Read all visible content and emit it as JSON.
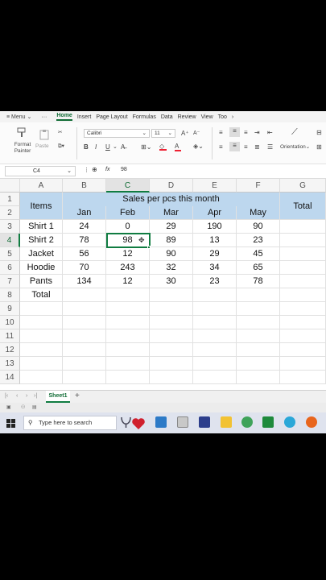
{
  "ribbon_tabs": [
    "Menu",
    "Home",
    "Insert",
    "Page Layout",
    "Formulas",
    "Data",
    "Review",
    "View",
    "Too"
  ],
  "ribbon": {
    "format_painter": "Format Painter",
    "paste": "Paste",
    "font_name": "Calibri",
    "font_size": "11",
    "orientation": "Orientation"
  },
  "formula_bar": {
    "name_box": "C4",
    "fx_label": "fx",
    "formula": "98"
  },
  "columns": [
    "A",
    "B",
    "C",
    "D",
    "E",
    "F",
    "G"
  ],
  "rows": [
    "1",
    "2",
    "3",
    "4",
    "5",
    "6",
    "7",
    "8",
    "9",
    "10",
    "11",
    "12",
    "13",
    "14"
  ],
  "table": {
    "items_header": "Items",
    "title": "Sales per pcs this month",
    "total_header": "Total",
    "months": [
      "Jan",
      "Feb",
      "Mar",
      "Apr",
      "May"
    ],
    "data_rows": [
      {
        "item": "Shirt 1",
        "values": [
          "24",
          "0",
          "29",
          "190",
          "90"
        ]
      },
      {
        "item": "Shirt 2",
        "values": [
          "78",
          "98",
          "89",
          "13",
          "23"
        ]
      },
      {
        "item": "Jacket",
        "values": [
          "56",
          "12",
          "90",
          "29",
          "45"
        ]
      },
      {
        "item": "Hoodie",
        "values": [
          "70",
          "243",
          "32",
          "34",
          "65"
        ]
      },
      {
        "item": "Pants",
        "values": [
          "134",
          "12",
          "30",
          "23",
          "78"
        ]
      }
    ],
    "total_row_label": "Total"
  },
  "active_cell": "C4",
  "sheet_tab": "Sheet1",
  "taskbar": {
    "search_placeholder": "Type here to search"
  },
  "colors": {
    "header_fill": "#bdd7ee",
    "excel_green": "#107c41"
  }
}
